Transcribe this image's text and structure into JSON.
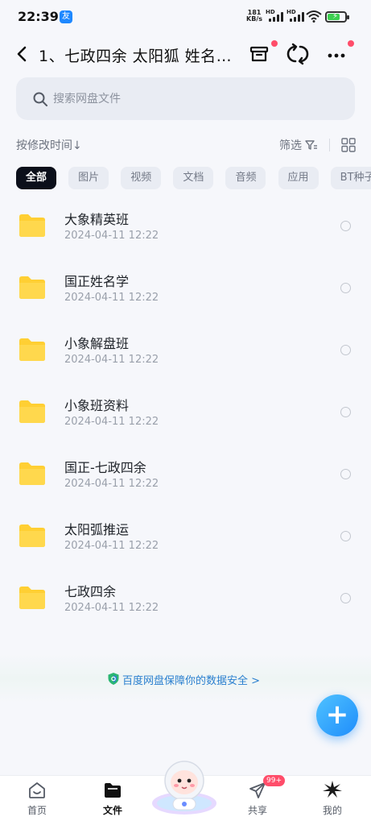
{
  "status_bar": {
    "time": "22:39",
    "app_badge": "友",
    "net_speed_value": "181",
    "net_speed_unit": "KB/s",
    "signal_1_label": "HD",
    "signal_2_label": "HD",
    "battery_level": 0.65
  },
  "header": {
    "title": "1、七政四余 太阳狐 姓名…"
  },
  "search": {
    "placeholder": "搜索网盘文件"
  },
  "sort": {
    "label": "按修改时间↓",
    "filter_label": "筛选"
  },
  "categories": [
    "全部",
    "图片",
    "视频",
    "文档",
    "音频",
    "应用",
    "BT种子"
  ],
  "files": [
    {
      "name": "大象精英班",
      "date": "2024-04-11  12:22"
    },
    {
      "name": "国正姓名学",
      "date": "2024-04-11  12:22"
    },
    {
      "name": "小象解盘班",
      "date": "2024-04-11  12:22"
    },
    {
      "name": "小象班资料",
      "date": "2024-04-11  12:22"
    },
    {
      "name": "国正-七政四余",
      "date": "2024-04-11  12:22"
    },
    {
      "name": "太阳弧推运",
      "date": "2024-04-11  12:22"
    },
    {
      "name": "七政四余",
      "date": "2024-04-11  12:22"
    }
  ],
  "safety_banner": {
    "text": "百度网盘保障你的数据安全 >"
  },
  "fab": {
    "symbol": "+"
  },
  "bottom_nav": {
    "home": "首页",
    "files": "文件",
    "share": "共享",
    "share_badge": "99+",
    "me": "我的"
  },
  "colors": {
    "accent": "#1f8dfb",
    "folder": "#ffcf33",
    "badge": "#ff4d6a",
    "active_chip": "#0b0f1a"
  }
}
